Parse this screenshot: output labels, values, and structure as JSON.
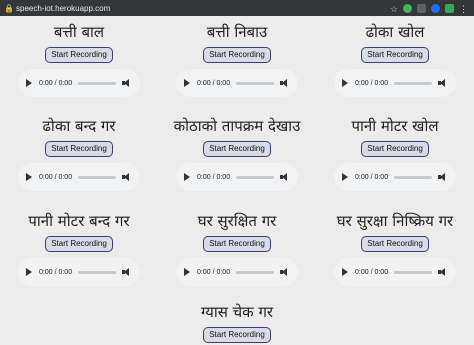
{
  "browser": {
    "url": "speech-iot.herokuapp.com"
  },
  "controls": [
    {
      "title": "बत्ती बाल",
      "button": "Start Recording",
      "time": "0:00 / 0:00"
    },
    {
      "title": "बत्ती निबाउ",
      "button": "Start Recording",
      "time": "0:00 / 0:00"
    },
    {
      "title": "ढोका खोल",
      "button": "Start Recording",
      "time": "0:00 / 0:00"
    },
    {
      "title": "ढोका बन्द गर",
      "button": "Start Recording",
      "time": "0:00 / 0:00"
    },
    {
      "title": "कोठाको तापक्रम देखाउ",
      "button": "Start Recording",
      "time": "0:00 / 0:00"
    },
    {
      "title": "पानी मोटर खोल",
      "button": "Start Recording",
      "time": "0:00 / 0:00"
    },
    {
      "title": "पानी मोटर बन्द गर",
      "button": "Start Recording",
      "time": "0:00 / 0:00"
    },
    {
      "title": "घर सुरक्षित गर",
      "button": "Start Recording",
      "time": "0:00 / 0:00"
    },
    {
      "title": "घर सुरक्षा निष्क्रिय गर",
      "button": "Start Recording",
      "time": "0:00 / 0:00"
    },
    {
      "title": "ग्यास चेक गर",
      "button": "Start Recording",
      "time": ""
    }
  ]
}
